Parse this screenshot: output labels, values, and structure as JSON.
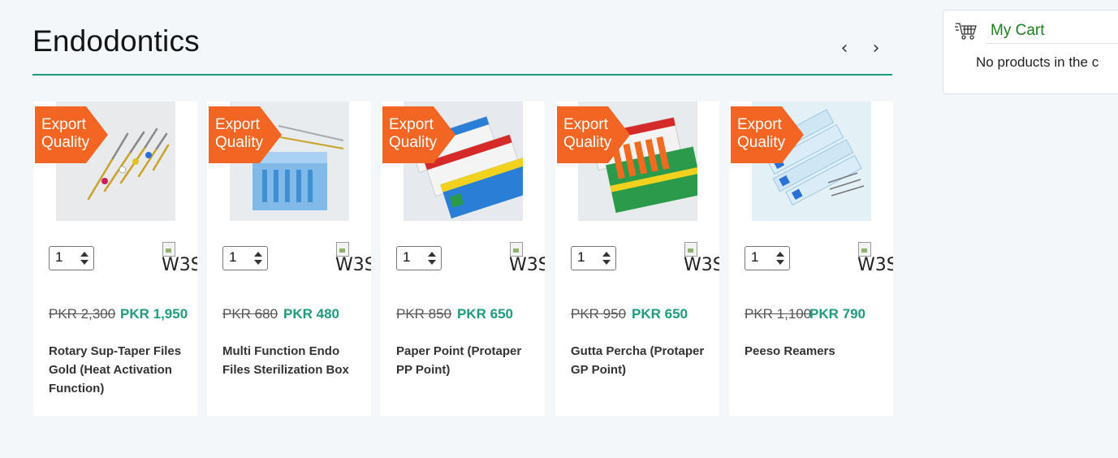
{
  "section": {
    "title": "Endodontics",
    "prev_label": "‹",
    "next_label": "›"
  },
  "cart": {
    "title": "My Cart",
    "empty_text": "No products in the c",
    "icon": "shopping-cart-icon"
  },
  "colors": {
    "accent": "#1f9b7f",
    "badge": "#f26522",
    "cart_title": "#1b7e1b"
  },
  "badge_lines": [
    "Export",
    "Quality"
  ],
  "products": [
    {
      "name": "Rotary Sup-Taper Files Gold (Heat Activation Function)",
      "old_price": "PKR 2,300",
      "new_price": "PKR 1,950",
      "qty": "1",
      "img_alt": "W3S"
    },
    {
      "name": "Multi Function Endo Files Sterilization Box",
      "old_price": "PKR 680",
      "new_price": "PKR 480",
      "qty": "1",
      "img_alt": "W3S"
    },
    {
      "name": "Paper Point (Protaper PP Point)",
      "old_price": "PKR 850",
      "new_price": "PKR 650",
      "qty": "1",
      "img_alt": "W3S"
    },
    {
      "name": "Gutta Percha (Protaper GP Point)",
      "old_price": "PKR 950",
      "new_price": "PKR 650",
      "qty": "1",
      "img_alt": "W3S"
    },
    {
      "name": "Peeso Reamers",
      "old_price": "PKR 1,100",
      "new_price": "PKR 790",
      "qty": "1",
      "img_alt": "W3S"
    }
  ]
}
